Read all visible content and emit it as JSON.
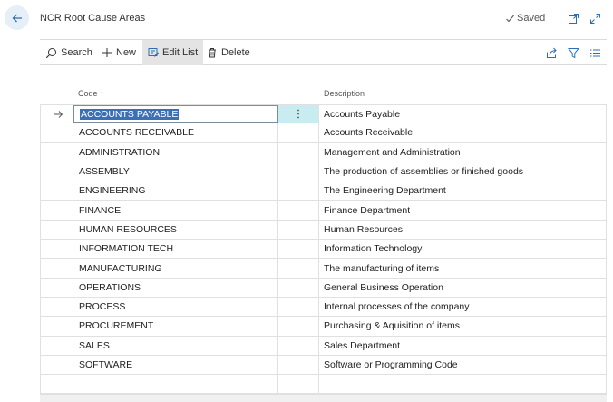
{
  "header": {
    "title": "NCR Root Cause Areas",
    "saved_label": "Saved",
    "icons": [
      "back-arrow-icon",
      "check-icon",
      "open-new-window-icon",
      "expand-icon"
    ]
  },
  "toolbar": {
    "search_label": "Search",
    "new_label": "New",
    "edit_list_label": "Edit List",
    "delete_label": "Delete",
    "right_icons": [
      "share-icon",
      "filter-icon",
      "list-view-icon"
    ]
  },
  "table": {
    "columns": {
      "code": "Code ↑",
      "description": "Description"
    },
    "rows": [
      {
        "code": "ACCOUNTS PAYABLE",
        "description": "Accounts Payable"
      },
      {
        "code": "ACCOUNTS RECEIVABLE",
        "description": "Accounts Receivable"
      },
      {
        "code": "ADMINISTRATION",
        "description": "Management and Administration"
      },
      {
        "code": "ASSEMBLY",
        "description": "The production of assemblies or finished goods"
      },
      {
        "code": "ENGINEERING",
        "description": "The Engineering Department"
      },
      {
        "code": "FINANCE",
        "description": "Finance Department"
      },
      {
        "code": "HUMAN RESOURCES",
        "description": "Human Resources"
      },
      {
        "code": "INFORMATION TECH",
        "description": "Information Technology"
      },
      {
        "code": "MANUFACTURING",
        "description": "The manufacturing of items"
      },
      {
        "code": "OPERATIONS",
        "description": "General Business Operation"
      },
      {
        "code": "PROCESS",
        "description": "Internal processes of the company"
      },
      {
        "code": "PROCUREMENT",
        "description": "Purchasing & Aquisition of items"
      },
      {
        "code": "SALES",
        "description": "Sales Department"
      },
      {
        "code": "SOFTWARE",
        "description": "Software or Programming Code"
      },
      {
        "code": "",
        "description": ""
      }
    ]
  },
  "colors": {
    "accent": "#3b6fb6",
    "selected_menu_bg": "#c8ecf0",
    "icon_blue": "#2c6fb7"
  }
}
